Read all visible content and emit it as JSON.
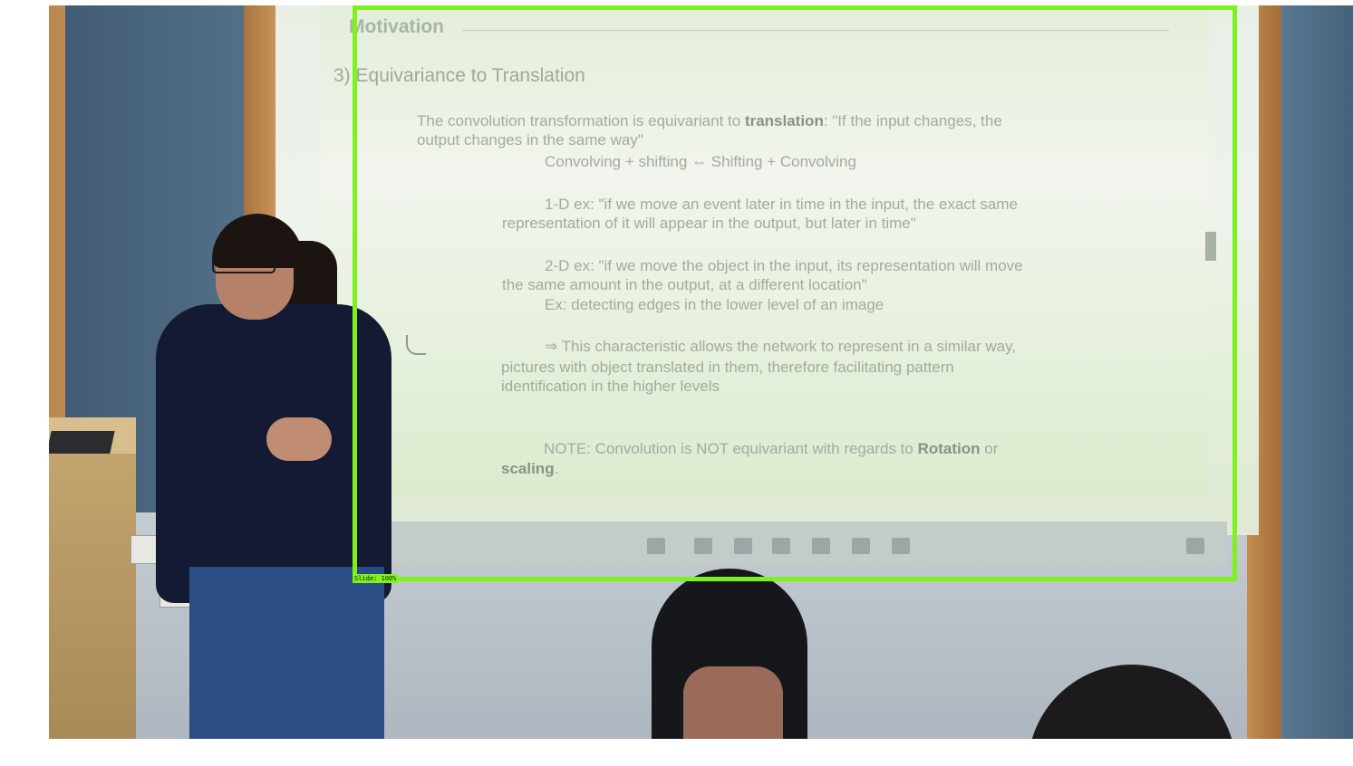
{
  "scene": {
    "description_kind": "classroom-lecture-photo",
    "accent": "#7ef21d"
  },
  "slide": {
    "title": "Motivation",
    "heading": "3) Equivariance to Translation",
    "intro_part1": "The convolution transformation is equivariant to ",
    "intro_bold": "translation",
    "intro_part2": ": \"If the input changes, the",
    "intro_line2": "output changes in the same way\"",
    "rule_line": "Convolving + shifting ⇔ Shifting + Convolving",
    "ex1_line1": "1-D ex: \"if we move an event later in time in the input, the exact same",
    "ex1_line2": "representation of it will appear in the output, but later in time\"",
    "ex2_line1": "2-D ex: \"if we move the object in the input, its representation will move",
    "ex2_line2": "the same amount in the output, at a different location\"",
    "ex2_line3": "Ex: detecting edges in the lower level of an image",
    "char_line1": "⇒ This characteristic allows the network to represent in a similar way,",
    "char_line2": "pictures with object translated in them, therefore facilitating pattern",
    "char_line3": "identification in the higher levels",
    "note_part1": "NOTE: Convolution is NOT equivariant with regards to ",
    "note_bold1": "Rotation",
    "note_part2": " or",
    "note_bold2": "scaling",
    "note_end": "."
  },
  "annotation": {
    "label": "Slide: 100%"
  },
  "icons": [
    "search-icon",
    "task-view-icon",
    "edge-icon",
    "file-explorer-icon",
    "store-icon",
    "app-icon",
    "excel-icon",
    "visual-studio-icon",
    "notification-icon"
  ]
}
